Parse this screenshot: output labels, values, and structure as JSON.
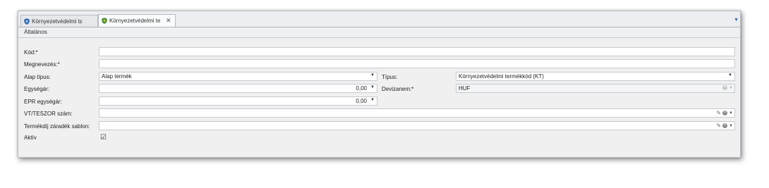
{
  "tabs": [
    {
      "label": "Környezetvédelmi tɛ",
      "active": false
    },
    {
      "label": "Környezetvédelmi te",
      "active": true,
      "close": "✕"
    }
  ],
  "group": {
    "title": "Általános"
  },
  "form": {
    "kod": {
      "label": "Kód:*",
      "value": ""
    },
    "megnevezes": {
      "label": "Megnevezés:*",
      "value": ""
    },
    "alap_tipus": {
      "label": "Alap típus:",
      "value": "Alap termék"
    },
    "tipus": {
      "label": "Típus:",
      "value": "Környezetvédelmi termékkód (KT)"
    },
    "egysegar": {
      "label": "Egységár:",
      "value": "0,00"
    },
    "devizanem": {
      "label": "Devizanem:*",
      "value": "HUF"
    },
    "epr_egysegar": {
      "label": "EPR egységár:",
      "value": "0,00"
    },
    "vt_teszor": {
      "label": "VT/TESZOR szám:",
      "value": ""
    },
    "termekdij": {
      "label": "Termékdíj záradék sablon:",
      "value": ""
    },
    "aktiv": {
      "label": "Aktív",
      "checked": true
    }
  },
  "colors": {
    "accent": "#2a5aa8",
    "background": "#f0f0f0"
  }
}
